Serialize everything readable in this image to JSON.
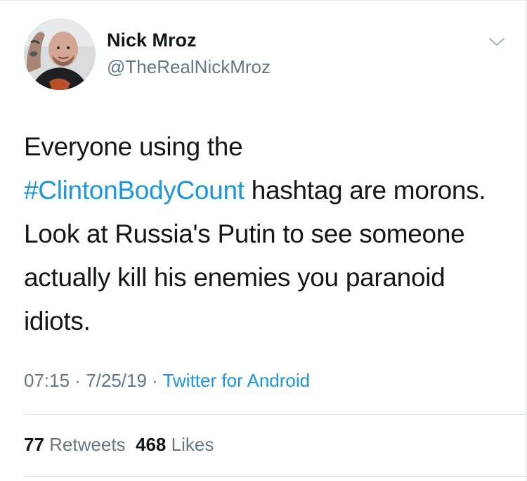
{
  "user": {
    "name": "Nick Mroz",
    "handle": "@TheRealNickMroz"
  },
  "tweet": {
    "text_before": "Everyone using the ",
    "hashtag": "#ClintonBodyCount",
    "text_after": " hashtag are morons. Look at Russia's Putin to see someone actually kill his enemies you paranoid idiots."
  },
  "meta": {
    "time": "07:15",
    "separator1": " · ",
    "date": "7/25/19",
    "separator2": " · ",
    "source": "Twitter for Android"
  },
  "stats": {
    "retweets_count": "77",
    "retweets_label": "Retweets",
    "likes_count": "468",
    "likes_label": "Likes"
  },
  "icons": {
    "caret": "chevron-down-icon"
  },
  "colors": {
    "link": "#1b95e0",
    "secondary": "#657786",
    "text": "#14171a"
  }
}
